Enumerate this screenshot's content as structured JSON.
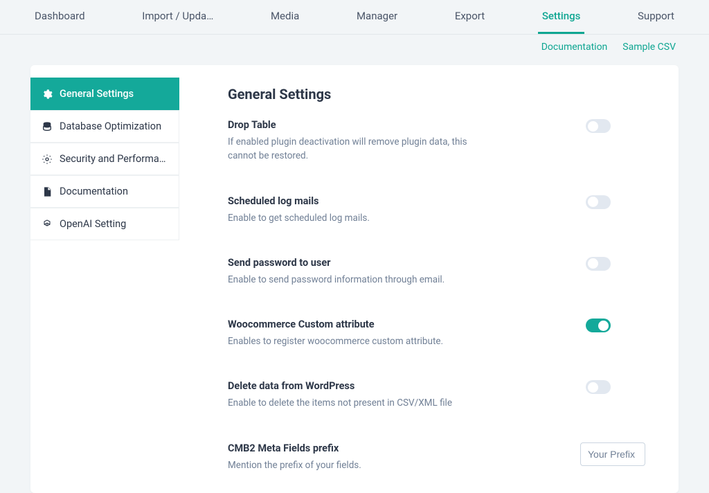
{
  "nav": {
    "items": [
      "Dashboard",
      "Import / Upda…",
      "Media",
      "Manager",
      "Export",
      "Settings",
      "Support"
    ],
    "active_index": 5
  },
  "sublinks": {
    "documentation": "Documentation",
    "sample_csv": "Sample CSV"
  },
  "sidebar": {
    "items": [
      {
        "label": "General Settings",
        "icon": "gear-icon"
      },
      {
        "label": "Database Optimization",
        "icon": "database-icon"
      },
      {
        "label": "Security and Performa…",
        "icon": "cog-icon"
      },
      {
        "label": "Documentation",
        "icon": "file-icon"
      },
      {
        "label": "OpenAI Setting",
        "icon": "openai-icon"
      }
    ],
    "active_index": 0
  },
  "content": {
    "heading": "General Settings",
    "settings": [
      {
        "title": "Drop Table",
        "desc": "If enabled plugin deactivation will remove plugin data, this cannot be restored.",
        "type": "toggle",
        "value": false
      },
      {
        "title": "Scheduled log mails",
        "desc": "Enable to get scheduled log mails.",
        "type": "toggle",
        "value": false
      },
      {
        "title": "Send password to user",
        "desc": "Enable to send password information through email.",
        "type": "toggle",
        "value": false
      },
      {
        "title": "Woocommerce Custom attribute",
        "desc": "Enables to register woocommerce custom attribute.",
        "type": "toggle",
        "value": true
      },
      {
        "title": "Delete data from WordPress",
        "desc": "Enable to delete the items not present in CSV/XML file",
        "type": "toggle",
        "value": false
      },
      {
        "title": "CMB2 Meta Fields prefix",
        "desc": "Mention the prefix of your fields.",
        "type": "input",
        "placeholder": "Your Prefix"
      }
    ]
  }
}
